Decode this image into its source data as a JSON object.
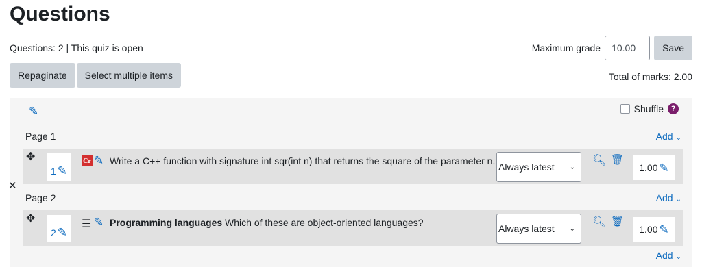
{
  "page": {
    "title": "Questions",
    "meta": "Questions: 2 | This quiz is open",
    "max_grade_label": "Maximum grade",
    "max_grade_value": "10.00",
    "save_label": "Save",
    "repaginate_label": "Repaginate",
    "select_multiple_label": "Select multiple items",
    "total_marks": "Total of marks: 2.00"
  },
  "section": {
    "shuffle_label": "Shuffle"
  },
  "pages": [
    {
      "label": "Page 1",
      "add_label": "Add"
    },
    {
      "label": "Page 2",
      "add_label": "Add"
    }
  ],
  "final_add_label": "Add",
  "slots": [
    {
      "number": "1",
      "type_icon": "coderunner-icon",
      "name": "",
      "text": "Write a C++ function with signature int sqr(int n) that returns the square of the parameter n.",
      "version": "Always latest",
      "mark": "1.00"
    },
    {
      "number": "2",
      "type_icon": "multichoice-icon",
      "name": "Programming languages",
      "text": "Which of these are object-oriented languages?",
      "version": "Always latest",
      "mark": "1.00"
    }
  ],
  "colors": {
    "link": "#0f6cbf",
    "button_bg": "#ced4da",
    "panel_bg": "#f5f5f5",
    "slot_bg": "#e1e1e1"
  }
}
